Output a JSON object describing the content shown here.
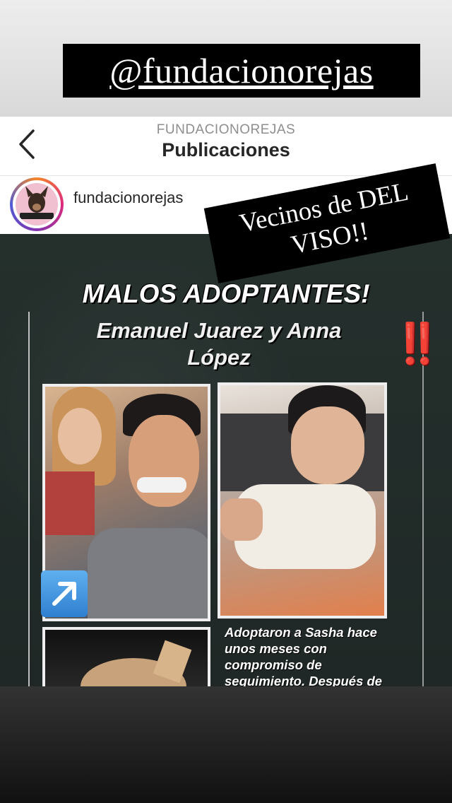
{
  "story": {
    "mention_sticker": "@fundacionorejas",
    "text_sticker_line1": "Vecinos de DEL",
    "text_sticker_line2": "VISO!!"
  },
  "header": {
    "username": "FUNDACIONOREJAS",
    "title": "Publicaciones",
    "back_icon": "chevron-left-icon"
  },
  "post": {
    "username": "fundacionorejas",
    "headline": "MALOS ADOPTANTES!",
    "names_line1": "Emanuel Juarez y Anna",
    "names_line2": "López",
    "exclamation": "‼️",
    "caption_line1": "Adoptaron a Sasha hace",
    "caption_line2": "unos meses con",
    "caption_line3": "compromiso de",
    "caption_line4": "seguimiento. Después de",
    "arrow_icon": "up-right-arrow-icon"
  },
  "colors": {
    "accent_red": "#e01818",
    "board": "#25302d"
  }
}
